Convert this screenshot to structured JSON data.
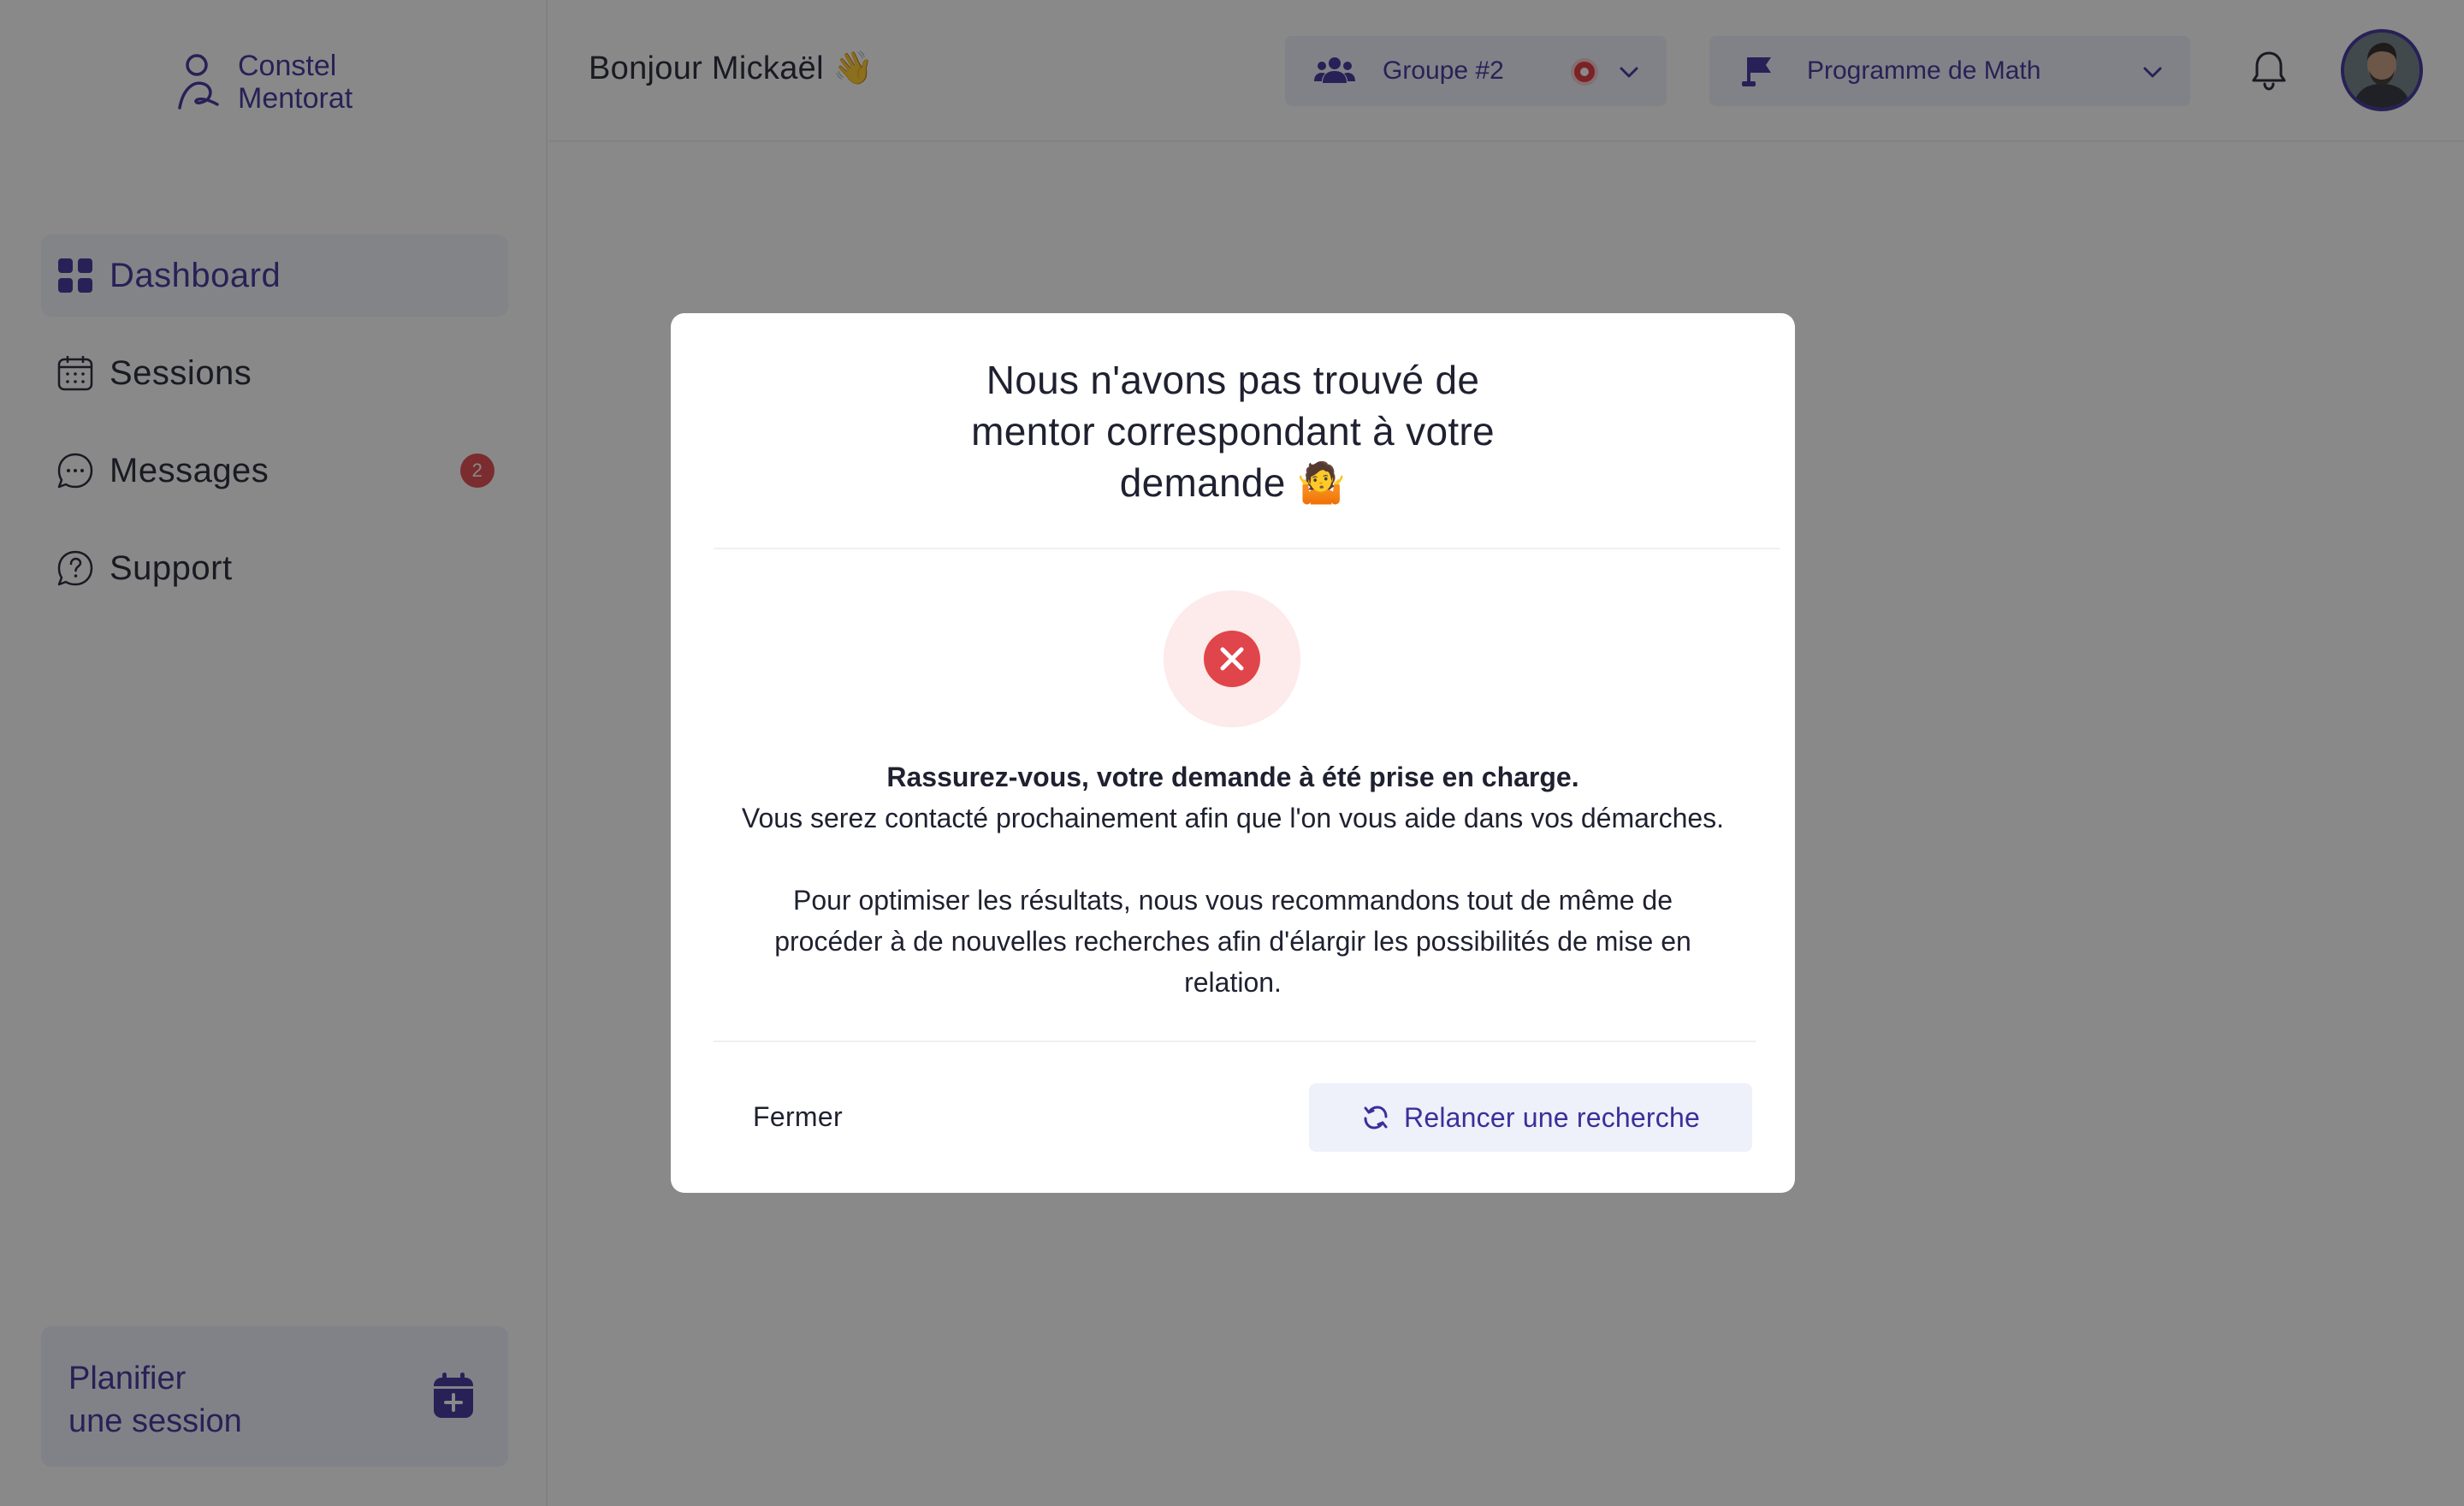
{
  "brand": {
    "line1": "Constel",
    "line2": "Mentorat"
  },
  "sidebar": {
    "items": [
      {
        "label": "Dashboard",
        "icon": "grid-icon",
        "active": true
      },
      {
        "label": "Sessions",
        "icon": "calendar-icon"
      },
      {
        "label": "Messages",
        "icon": "chat-icon",
        "badge": "2"
      },
      {
        "label": "Support",
        "icon": "help-icon"
      }
    ],
    "plan": {
      "line1": "Planifier",
      "line2": "une session",
      "icon": "calendar-plus-icon"
    }
  },
  "header": {
    "greeting": "Bonjour Mickaël 👋",
    "group": {
      "label": "Groupe #2",
      "icon": "users-icon"
    },
    "program": {
      "label": "Programme de Math",
      "icon": "flag-icon"
    }
  },
  "modal": {
    "title_line1": "Nous n'avons pas trouvé de",
    "title_line2": "mentor correspondant à votre",
    "title_line3": "demande 🤷",
    "line1": "Rassurez-vous, votre demande à été prise en charge.",
    "line2": "Vous serez contacté prochainement afin que l'on vous aide dans vos démarches.",
    "para2": "Pour optimiser les résultats, nous vous recommandons tout de même de procéder à de nouvelles recherches afin d'élargir les possibilités de mise en relation.",
    "close_label": "Fermer",
    "retry_label": "Relancer une recherche"
  },
  "colors": {
    "accent": "#3b2f9a",
    "danger": "#e0454b",
    "soft": "#eef0fa"
  }
}
